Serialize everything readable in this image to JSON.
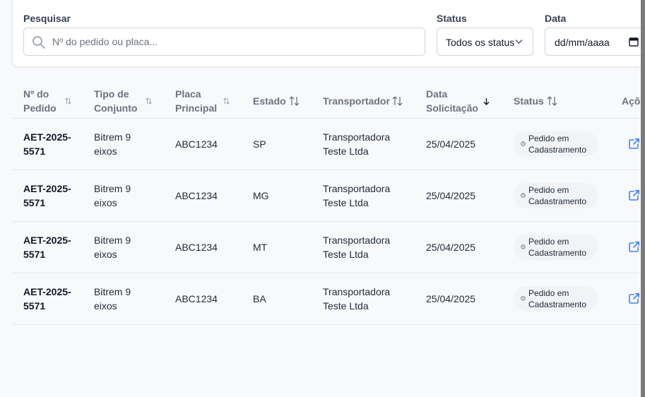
{
  "filters": {
    "search_label": "Pesquisar",
    "search_placeholder": "Nº do pedido ou placa...",
    "status_label": "Status",
    "status_value": "Todos os status",
    "date_label": "Data",
    "date_value": "dd/mm/aaaa"
  },
  "table": {
    "headers": {
      "pedido_1": "Nº do",
      "pedido_2": "Pedido",
      "tipo_1": "Tipo de",
      "tipo_2": "Conjunto",
      "placa_1": "Placa",
      "placa_2": "Principal",
      "estado": "Estado",
      "transportador": "Transportador",
      "data_1": "Data",
      "data_2": "Solicitação",
      "status": "Status",
      "acoes": "Açõ"
    },
    "rows": [
      {
        "pedido_1": "AET-2025-",
        "pedido_2": "5571",
        "tipo_1": "Bitrem 9",
        "tipo_2": "eixos",
        "placa": "ABC1234",
        "estado": "SP",
        "transp_1": "Transportadora",
        "transp_2": "Teste Ltda",
        "data": "25/04/2025",
        "status_1": "Pedido em",
        "status_2": "Cadastramento"
      },
      {
        "pedido_1": "AET-2025-",
        "pedido_2": "5571",
        "tipo_1": "Bitrem 9",
        "tipo_2": "eixos",
        "placa": "ABC1234",
        "estado": "MG",
        "transp_1": "Transportadora",
        "transp_2": "Teste Ltda",
        "data": "25/04/2025",
        "status_1": "Pedido em",
        "status_2": "Cadastramento"
      },
      {
        "pedido_1": "AET-2025-",
        "pedido_2": "5571",
        "tipo_1": "Bitrem 9",
        "tipo_2": "eixos",
        "placa": "ABC1234",
        "estado": "MT",
        "transp_1": "Transportadora",
        "transp_2": "Teste Ltda",
        "data": "25/04/2025",
        "status_1": "Pedido em",
        "status_2": "Cadastramento"
      },
      {
        "pedido_1": "AET-2025-",
        "pedido_2": "5571",
        "tipo_1": "Bitrem 9",
        "tipo_2": "eixos",
        "placa": "ABC1234",
        "estado": "BA",
        "transp_1": "Transportadora",
        "transp_2": "Teste Ltda",
        "data": "25/04/2025",
        "status_1": "Pedido em",
        "status_2": "Cadastramento"
      }
    ]
  },
  "icons": {
    "search": "search-icon",
    "chevron": "chevron-down-icon",
    "calendar": "calendar-icon",
    "sort": "sort-icon",
    "sort_desc": "arrow-down-icon",
    "status_dot": "clock-icon",
    "action": "external-link-icon"
  },
  "colors": {
    "accent": "#3b82f6",
    "badge_bg": "#f1f3f6",
    "header_text": "#6b7280"
  }
}
